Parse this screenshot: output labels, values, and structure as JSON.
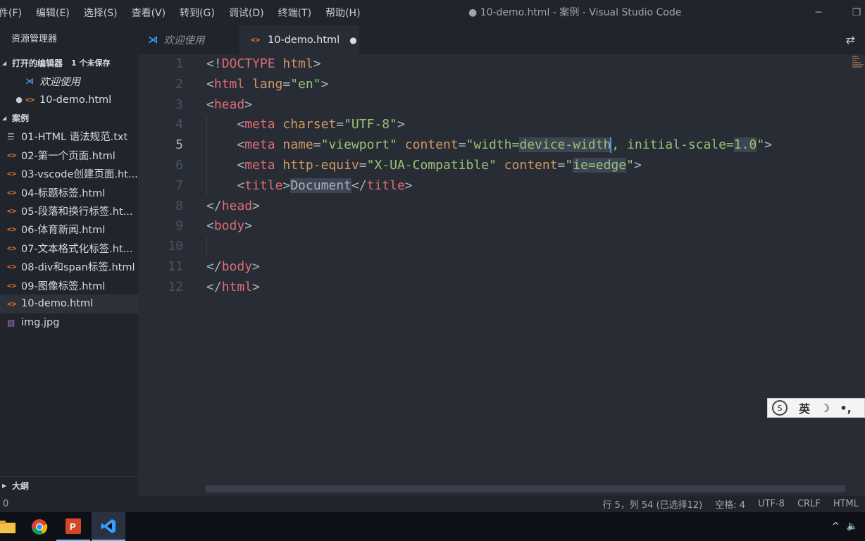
{
  "menu": [
    "件(F)",
    "编辑(E)",
    "选择(S)",
    "查看(V)",
    "转到(G)",
    "调试(D)",
    "终端(T)",
    "帮助(H)"
  ],
  "window": {
    "title": "● 10-demo.html - 案例 - Visual Studio Code",
    "minimize": "─",
    "restore": "❐"
  },
  "sidebar": {
    "header": "资源管理器",
    "open_editors": {
      "label": "打开的编辑器",
      "unsaved": "1 个未保存",
      "items": [
        {
          "label": "欢迎使用",
          "icon": "vscode-icon"
        },
        {
          "label": "10-demo.html",
          "icon": "html-icon",
          "dirty": "●"
        }
      ]
    },
    "workspace": {
      "label": "案例",
      "files": [
        {
          "label": "01-HTML 语法规范.txt",
          "icon": "text-file-icon"
        },
        {
          "label": "02-第一个页面.html",
          "icon": "html-icon"
        },
        {
          "label": "03-vscode创建页面.ht...",
          "icon": "html-icon"
        },
        {
          "label": "04-标题标签.html",
          "icon": "html-icon"
        },
        {
          "label": "05-段落和换行标签.ht...",
          "icon": "html-icon"
        },
        {
          "label": "06-体育新闻.html",
          "icon": "html-icon"
        },
        {
          "label": "07-文本格式化标签.ht...",
          "icon": "html-icon"
        },
        {
          "label": "08-div和span标签.html",
          "icon": "html-icon"
        },
        {
          "label": "09-图像标签.html",
          "icon": "html-icon"
        },
        {
          "label": "10-demo.html",
          "icon": "html-icon"
        },
        {
          "label": "img.jpg",
          "icon": "image-icon"
        }
      ]
    },
    "outline": "大纲"
  },
  "tabs": {
    "welcome": "欢迎使用",
    "active": "10-demo.html",
    "dirty_mark": "●"
  },
  "editor": {
    "line_numbers": [
      "1",
      "2",
      "3",
      "4",
      "5",
      "6",
      "7",
      "8",
      "9",
      "10",
      "11",
      "12"
    ],
    "active_line": "5",
    "lines": {
      "l1": [
        "<!",
        "DOCTYPE",
        " html",
        ">"
      ],
      "l2": [
        "<",
        "html",
        " lang",
        "=",
        "\"en\"",
        ">"
      ],
      "l3": [
        "<",
        "head",
        ">"
      ],
      "l4": [
        "    <",
        "meta",
        " charset",
        "=",
        "\"UTF-8\"",
        ">"
      ],
      "l5": [
        "    <",
        "meta",
        " name",
        "=",
        "\"viewport\"",
        " content",
        "=",
        "\"width=",
        "device-width",
        ", initial-scale=",
        "1.0",
        "\"",
        ">"
      ],
      "l6": [
        "    <",
        "meta",
        " http-equiv",
        "=",
        "\"X-UA-Compatible\"",
        " content",
        "=",
        "\"",
        "ie=edge",
        "\"",
        ">"
      ],
      "l7": [
        "    <",
        "title",
        ">",
        "Document",
        "</",
        "title",
        ">"
      ],
      "l8": [
        "</",
        "head",
        ">"
      ],
      "l9": [
        "<",
        "body",
        ">"
      ],
      "l11": [
        "</",
        "body",
        ">"
      ],
      "l12": [
        "</",
        "html",
        ">"
      ]
    }
  },
  "ime": {
    "mode": "英",
    "moon": "☽",
    "punct": "•,"
  },
  "statusbar": {
    "left": "0",
    "position": "行 5，列 54 (已选择12)",
    "spaces": "空格: 4",
    "encoding": "UTF-8",
    "eol": "CRLF",
    "language": "HTML"
  },
  "taskbar": {
    "tray_arrow": "^",
    "volume": "🔈"
  }
}
